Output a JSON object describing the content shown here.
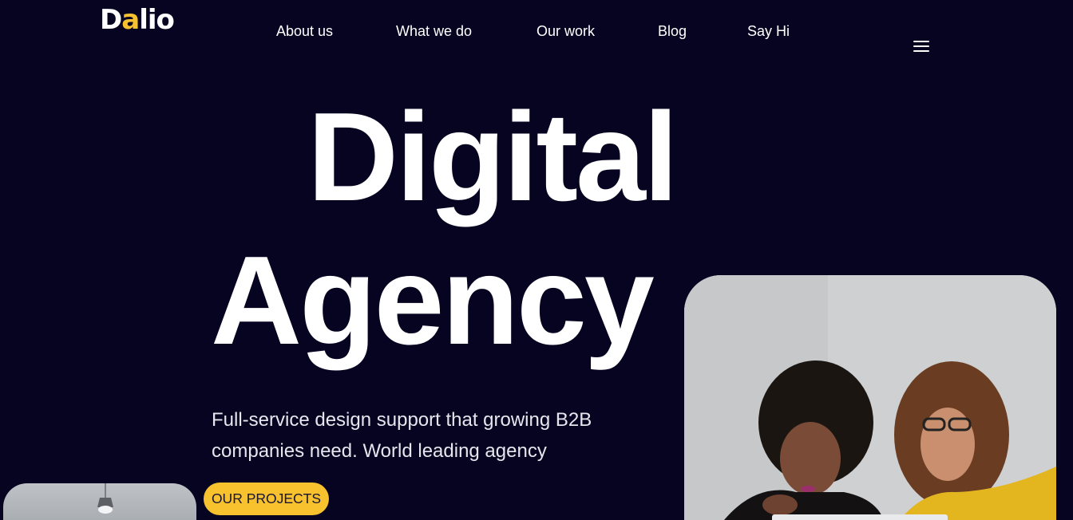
{
  "brand": {
    "logo_pre": "D",
    "logo_accent": "a",
    "logo_post": "lio"
  },
  "nav": {
    "items": [
      {
        "label": "About us"
      },
      {
        "label": "What we do"
      },
      {
        "label": "Our work"
      },
      {
        "label": "Blog"
      },
      {
        "label": "Say Hi"
      }
    ],
    "menu_icon": "hamburger-icon"
  },
  "hero": {
    "line1": "Digital",
    "line2": "Agency",
    "subtitle": "Full-service design support that growing B2B companies need. World leading agency",
    "cta_label": "OUR PROJECTS"
  },
  "colors": {
    "background": "#070421",
    "accent": "#f8c22e",
    "text": "#ffffff"
  }
}
